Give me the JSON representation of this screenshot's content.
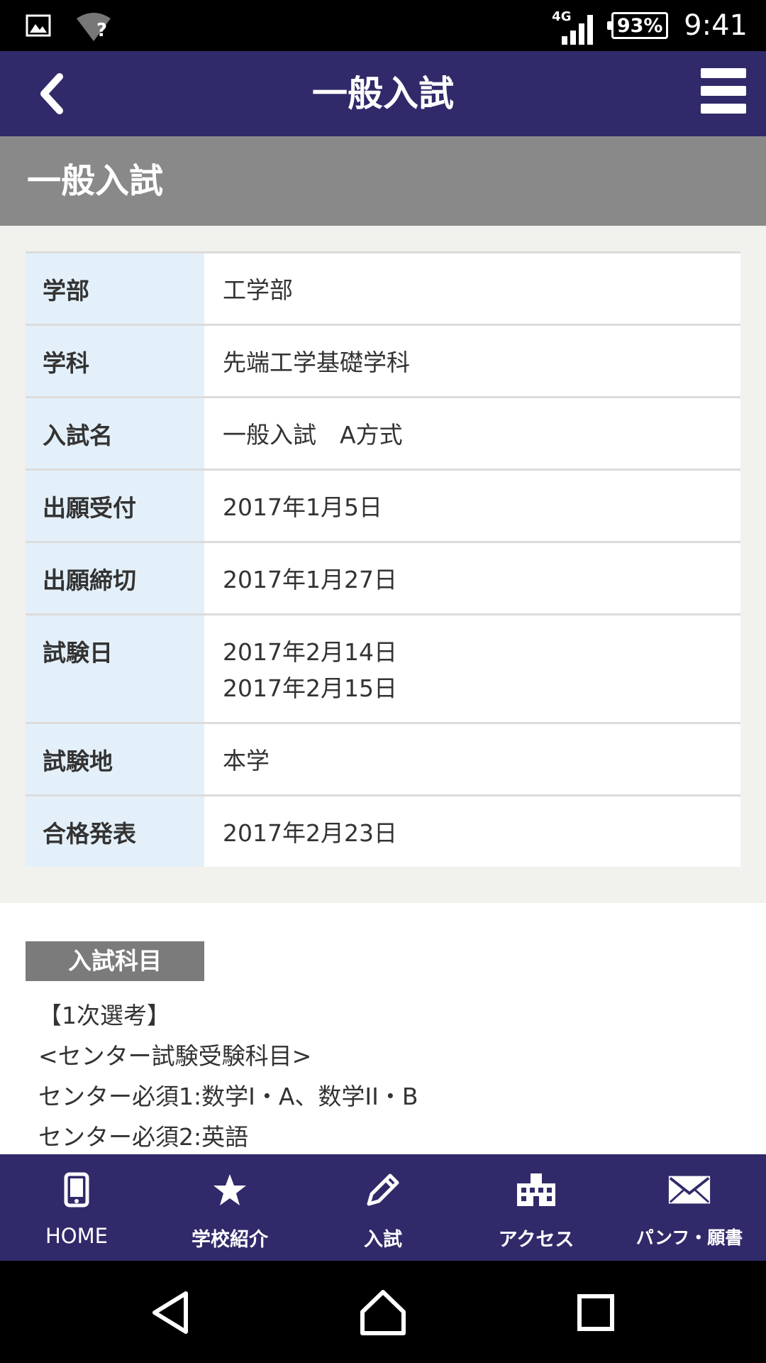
{
  "status_bar": {
    "network": "4G",
    "wifi_unknown": "?",
    "battery": "93%",
    "time": "9:41"
  },
  "app_bar": {
    "title": "一般入試",
    "back_icon": "chevron-left-icon",
    "menu_icon": "hamburger-menu-icon"
  },
  "section_title": "一般入試",
  "info_rows": [
    {
      "label": "学部",
      "value": "工学部"
    },
    {
      "label": "学科",
      "value": "先端工学基礎学科"
    },
    {
      "label": "入試名",
      "value": "一般入試　A方式"
    },
    {
      "label": "出願受付",
      "value": "2017年1月5日"
    },
    {
      "label": "出願締切",
      "value": "2017年1月27日"
    },
    {
      "label": "試験日",
      "value": "2017年2月14日",
      "value2": "2017年2月15日"
    },
    {
      "label": "試験地",
      "value": "本学"
    },
    {
      "label": "合格発表",
      "value": "2017年2月23日"
    }
  ],
  "subjects": {
    "badge": "入試科目",
    "lines": [
      "【1次選考】",
      "<センター試験受験科目>",
      "センター必須1:数学I・A、数学II・B",
      "センター必須2:英語"
    ]
  },
  "bottom_nav": [
    {
      "label": "HOME",
      "icon": "smartphone-icon"
    },
    {
      "label": "学校紹介",
      "icon": "star-icon"
    },
    {
      "label": "入試",
      "icon": "pencil-icon"
    },
    {
      "label": "アクセス",
      "icon": "school-building-icon"
    },
    {
      "label": "パンフ・願書",
      "icon": "envelope-icon"
    }
  ],
  "colors": {
    "app_bar": "#302a6a",
    "section_header": "#898989",
    "label_bg": "#e4f0f9",
    "info_area_bg": "#f1f1ee",
    "badge_bg": "#7b7b7b"
  }
}
